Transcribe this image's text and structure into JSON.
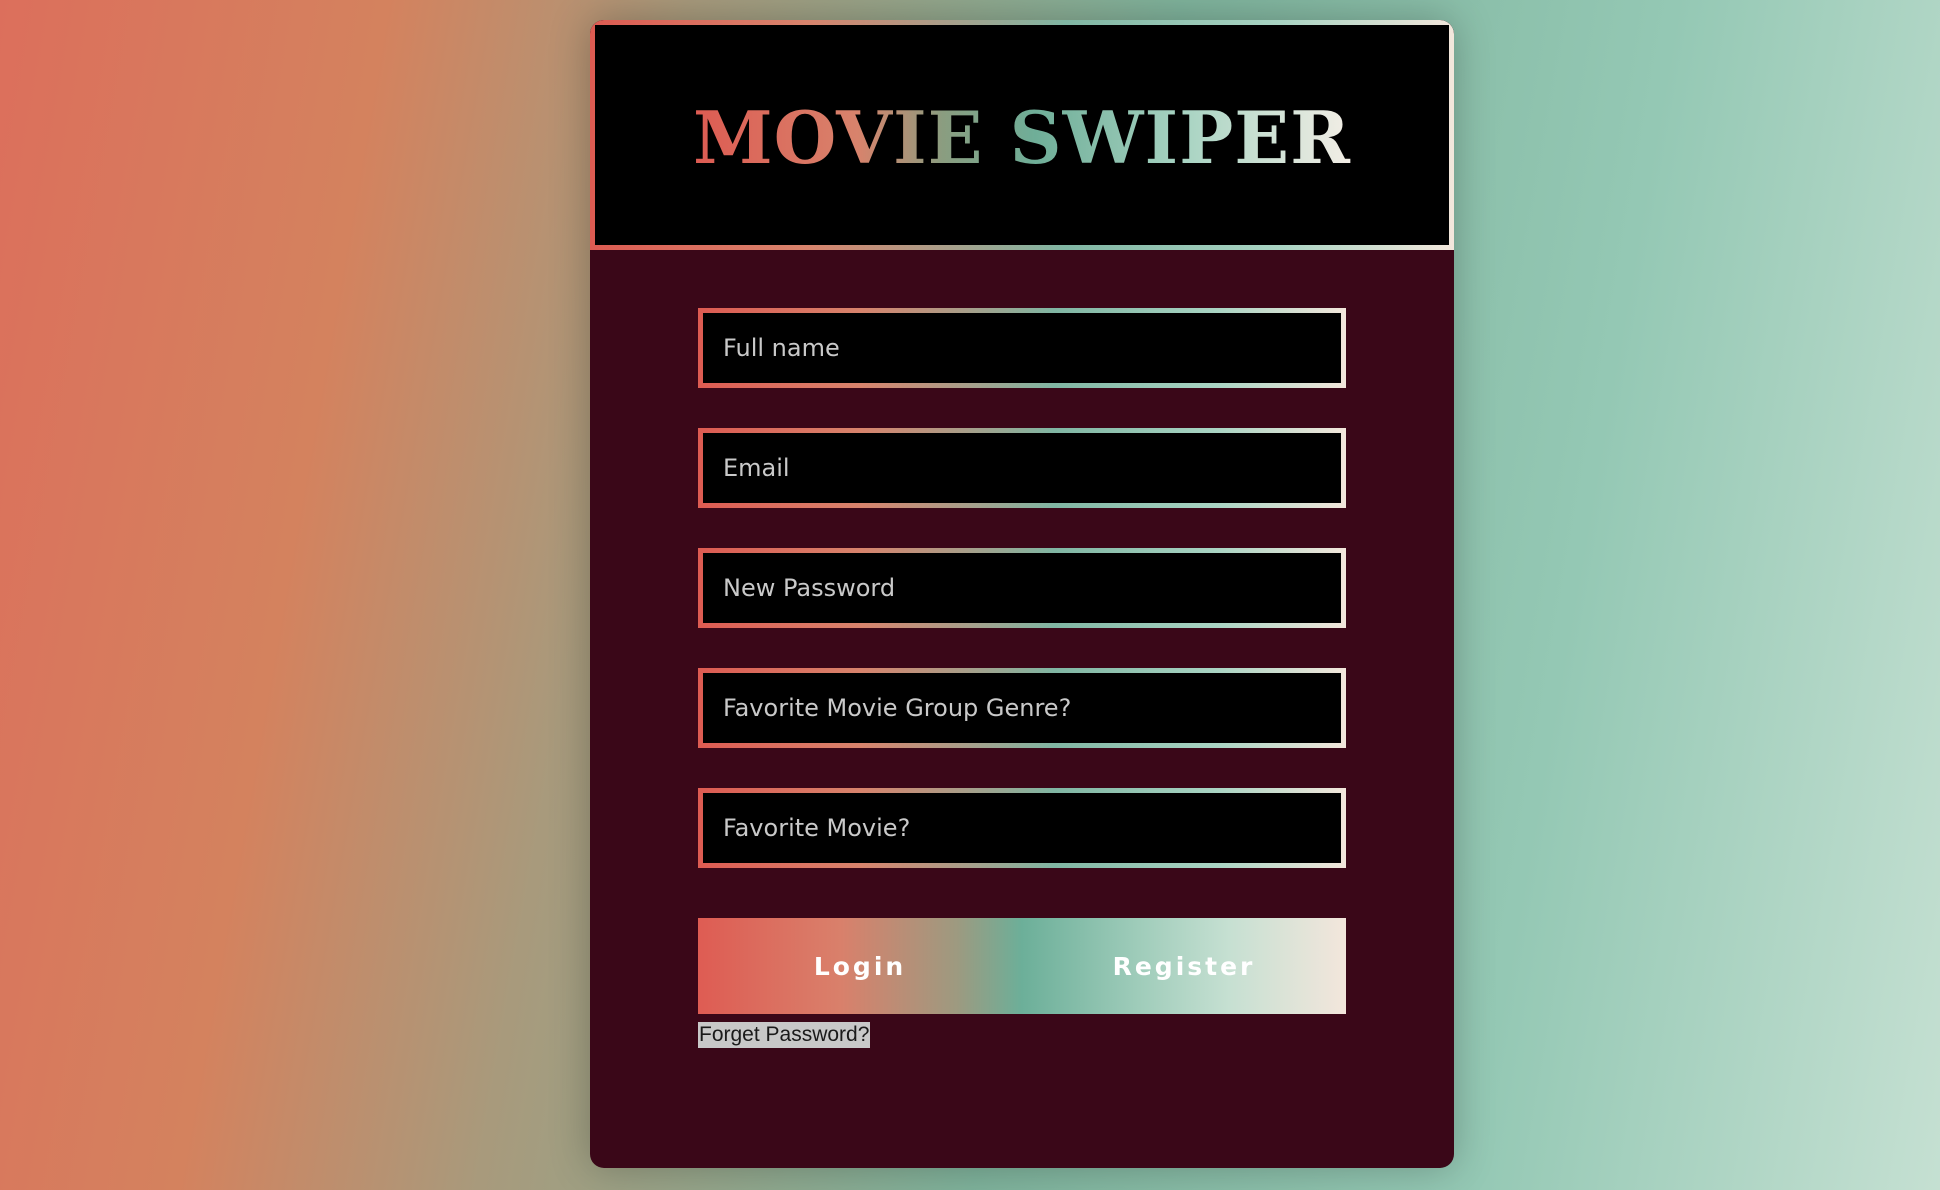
{
  "app": {
    "title": "MOVIE SWIPER"
  },
  "form": {
    "fields": [
      {
        "placeholder": "Full name",
        "value": ""
      },
      {
        "placeholder": "Email",
        "value": ""
      },
      {
        "placeholder": "New Password",
        "value": ""
      },
      {
        "placeholder": "Favorite Movie Group Genre?",
        "value": ""
      },
      {
        "placeholder": "Favorite Movie?",
        "value": ""
      }
    ],
    "login_label": "Login",
    "register_label": "Register",
    "forget_password_label": "Forget Password?"
  },
  "colors": {
    "card_background": "#3a0718",
    "accent_coral": "#dd5b52",
    "accent_teal": "#6fae98",
    "accent_cream": "#f3e7dc"
  }
}
